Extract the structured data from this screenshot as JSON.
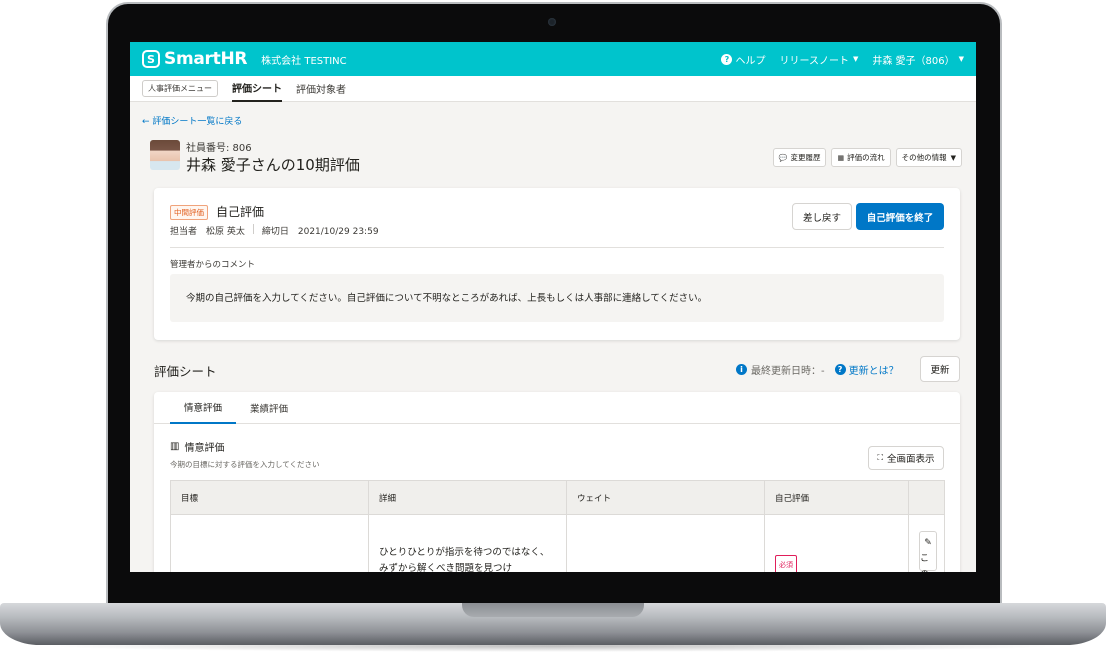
{
  "app": {
    "logo_mark": "S",
    "logo_text": "SmartHR",
    "company": "株式会社 TESTINC",
    "help_label": "ヘルプ",
    "release_notes_label": "リリースノート",
    "user_label": "井森 愛子（806）"
  },
  "subnav": {
    "menu_label": "人事評価メニュー",
    "tabs": [
      {
        "label": "評価シート",
        "active": true
      },
      {
        "label": "評価対象者",
        "active": false
      }
    ]
  },
  "page": {
    "back_label": "評価シート一覧に戻る",
    "employee_no": "社員番号: 806",
    "title": "井森 愛子さんの10期評価",
    "header_buttons": [
      "変更履歴",
      "評価の流れ",
      "その他の情報"
    ]
  },
  "evaluation": {
    "badge": "中間評価",
    "title": "自己評価",
    "assignee": "担当者　松原 英太",
    "deadline": "締切日　2021/10/29 23:59",
    "return_label": "差し戻す",
    "finish_label": "自己評価を終了",
    "comment_label": "管理者からのコメント",
    "comment": "今期の自己評価を入力してください。自己評価について不明なところがあれば、上長もしくは人事部に連絡してください。"
  },
  "sheet": {
    "section_title": "評価シート",
    "last_updated": "最終更新日時：-",
    "what_is_update": "更新とは？",
    "refresh_label": "更新",
    "tabs": [
      {
        "label": "情意評価",
        "active": true
      },
      {
        "label": "業績評価",
        "active": false
      }
    ],
    "grid_title": "情意評価",
    "grid_subtitle": "今期の目標に対する評価を入力してください",
    "fullscreen_label": "全画面表示",
    "columns": [
      "目標",
      "詳細",
      "ウェイト",
      "自己評価",
      ""
    ],
    "rows": [
      {
        "goal": "",
        "detail": "ひとりひとりが指示を待つのではなく、みずから解くべき問題を見つけ",
        "weight": "",
        "self_eval_badge": "必須",
        "edit_label": "この"
      }
    ]
  },
  "colors": {
    "brand": "#00c4cc",
    "primary": "#0077c7",
    "danger": "#e01e5a"
  }
}
